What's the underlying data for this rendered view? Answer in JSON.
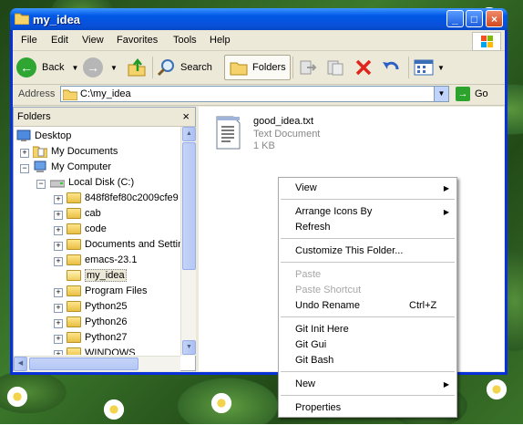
{
  "window": {
    "title": "my_idea"
  },
  "menubar": [
    "File",
    "Edit",
    "View",
    "Favorites",
    "Tools",
    "Help"
  ],
  "toolbar": {
    "back": "Back",
    "search": "Search",
    "folders": "Folders"
  },
  "address": {
    "label": "Address",
    "value": "C:\\my_idea",
    "go": "Go"
  },
  "folders_pane": {
    "title": "Folders",
    "close": "×",
    "tree": [
      {
        "label": "Desktop"
      },
      {
        "label": "My Documents"
      },
      {
        "label": "My Computer"
      },
      {
        "label": "Local Disk (C:)"
      },
      {
        "label": "848f8fef80c2009cfe9"
      },
      {
        "label": "cab"
      },
      {
        "label": "code"
      },
      {
        "label": "Documents and Settings"
      },
      {
        "label": "emacs-23.1"
      },
      {
        "label": "my_idea"
      },
      {
        "label": "Program Files"
      },
      {
        "label": "Python25"
      },
      {
        "label": "Python26"
      },
      {
        "label": "Python27"
      },
      {
        "label": "WINDOWS"
      }
    ]
  },
  "file": {
    "name": "good_idea.txt",
    "type": "Text Document",
    "size": "1 KB"
  },
  "context_menu": {
    "view": "View",
    "arrange": "Arrange Icons By",
    "refresh": "Refresh",
    "customize": "Customize This Folder...",
    "paste": "Paste",
    "paste_shortcut": "Paste Shortcut",
    "undo": "Undo Rename",
    "undo_shortcut": "Ctrl+Z",
    "git_init": "Git Init Here",
    "git_gui": "Git Gui",
    "git_bash": "Git Bash",
    "new": "New",
    "properties": "Properties"
  }
}
